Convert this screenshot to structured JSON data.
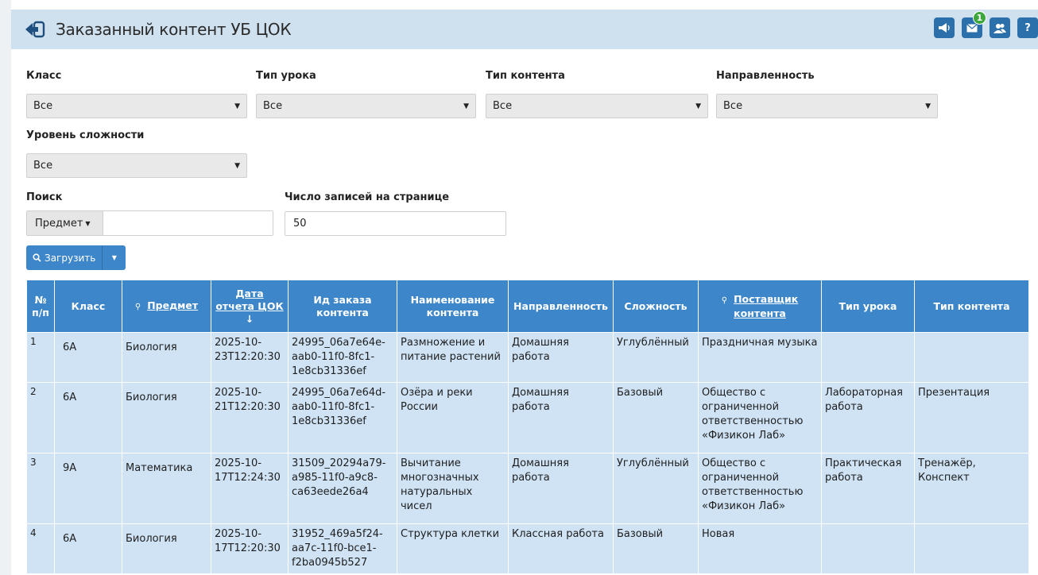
{
  "header": {
    "title": "Заказанный контент УБ ЦОК",
    "notifications_badge": "1",
    "help_label": "?"
  },
  "filters": {
    "class_label": "Класс",
    "class_value": "Все",
    "lesson_type_label": "Тип урока",
    "lesson_type_value": "Все",
    "content_type_label": "Тип контента",
    "content_type_value": "Все",
    "direction_label": "Направленность",
    "direction_value": "Все",
    "difficulty_label": "Уровень сложности",
    "difficulty_value": "Все",
    "search_label": "Поиск",
    "search_field_value": "Предмет",
    "search_input_value": "",
    "per_page_label": "Число записей на странице",
    "per_page_value": "50",
    "load_button_label": "Загрузить"
  },
  "table": {
    "columns": [
      "№ п/п",
      "Класс",
      "Предмет",
      "Дата отчета ЦОК",
      "Ид заказа контента",
      "Наименование контента",
      "Направленность",
      "Сложность",
      "Поставщик контента",
      "Тип урока",
      "Тип контента"
    ],
    "rows": [
      {
        "num": "1",
        "cls": "6А",
        "subject": "Биология",
        "date": "2025-10-23T12:20:30",
        "order_id": "24995_06a7e64e-aab0-11f0-8fc1-1e8cb31336ef",
        "name": "Размножение и питание растений",
        "direction": "Домашняя работа",
        "difficulty": "Углублённый",
        "provider": "Праздничная музыка",
        "lesson_type": "",
        "content_type": ""
      },
      {
        "num": "2",
        "cls": "6А",
        "subject": "Биология",
        "date": "2025-10-21T12:20:30",
        "order_id": "24995_06a7e64d-aab0-11f0-8fc1-1e8cb31336ef",
        "name": "Озёра и реки России",
        "direction": "Домашняя работа",
        "difficulty": "Базовый",
        "provider": "Общество с ограниченной ответственностью «Физикон Лаб»",
        "lesson_type": "Лабораторная работа",
        "content_type": "Презентация"
      },
      {
        "num": "3",
        "cls": "9А",
        "subject": "Математика",
        "date": "2025-10-17T12:24:30",
        "order_id": "31509_20294a79-a985-11f0-a9c8-ca63eede26a4",
        "name": "Вычитание многозначных натуральных чисел",
        "direction": "Домашняя работа",
        "difficulty": "Углублённый",
        "provider": "Общество с ограниченной ответственностью «Физикон Лаб»",
        "lesson_type": "Практическая работа",
        "content_type": "Тренажёр, Конспект"
      },
      {
        "num": "4",
        "cls": "6А",
        "subject": "Биология",
        "date": "2025-10-17T12:20:30",
        "order_id": "31952_469a5f24-aa7c-11f0-bce1-f2ba0945b527",
        "name": "Структура клетки",
        "direction": "Классная работа",
        "difficulty": "Базовый",
        "provider": "Новая",
        "lesson_type": "",
        "content_type": ""
      }
    ]
  }
}
